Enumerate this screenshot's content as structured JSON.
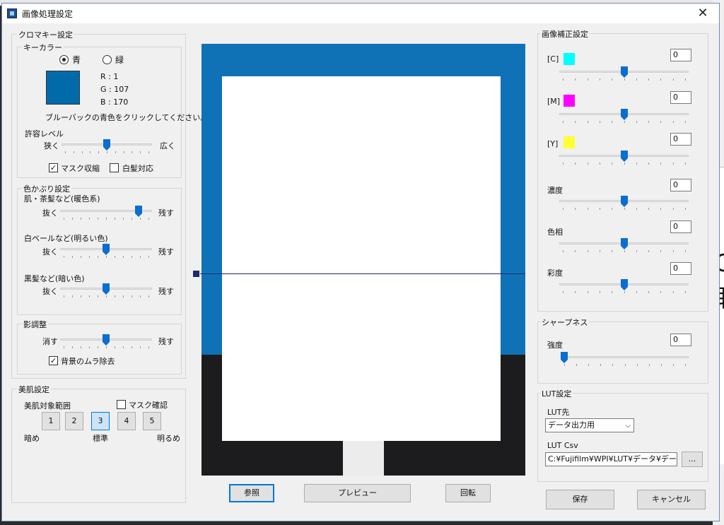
{
  "window": {
    "title": "画像処理設定"
  },
  "chroma": {
    "legend": "クロマキー設定",
    "keycolor": {
      "legend": "キーカラー",
      "blue_label": "青",
      "green_label": "緑",
      "selected": "blue",
      "swatch_color": "#016BAA",
      "r": "R : 1",
      "g": "G : 107",
      "b": "B : 170",
      "hint": "ブルーバックの青色をクリックしてください。"
    },
    "tolerance": {
      "label": "許容レベル",
      "left": "狭く",
      "right": "広く",
      "value": 0.5
    },
    "mask_shrink": {
      "label": "マスク収縮",
      "checked": true
    },
    "white_hair": {
      "label": "白髪対応",
      "checked": false
    }
  },
  "cast": {
    "legend": "色かぶり設定",
    "rows": [
      {
        "title": "肌・茶髪など(暖色系)",
        "left": "抜く",
        "right": "残す",
        "value": 0.88
      },
      {
        "title": "白ベールなど(明るい色)",
        "left": "抜く",
        "right": "残す",
        "value": 0.5
      },
      {
        "title": "黒髪など(暗い色)",
        "left": "抜く",
        "right": "残す",
        "value": 0.5
      }
    ]
  },
  "shadow": {
    "legend": "影調整",
    "left": "消す",
    "right": "残す",
    "value": 0.5,
    "bg_unevenness": {
      "label": "背景のムラ除去",
      "checked": true
    }
  },
  "skin": {
    "legend": "美肌設定",
    "range_label": "美肌対象範囲",
    "mask_check": {
      "label": "マスク確認",
      "checked": false
    },
    "levels": [
      "1",
      "2",
      "3",
      "4",
      "5"
    ],
    "selected_level": "3",
    "dark_label": "暗め",
    "standard_label": "標準",
    "bright_label": "明るめ"
  },
  "preview_buttons": {
    "browse": "参照",
    "preview": "プレビュー",
    "rotate": "回転"
  },
  "correction": {
    "legend": "画像補正設定",
    "rows": [
      {
        "label": "[C]",
        "swatch": "#00FFFF",
        "value": "0",
        "pos": 0.5
      },
      {
        "label": "[M]",
        "swatch": "#FF00FF",
        "value": "0",
        "pos": 0.5
      },
      {
        "label": "[Y]",
        "swatch": "#FFFF33",
        "value": "0",
        "pos": 0.5
      },
      {
        "label": "濃度",
        "swatch": "",
        "value": "0",
        "pos": 0.5
      },
      {
        "label": "色相",
        "swatch": "",
        "value": "0",
        "pos": 0.5
      },
      {
        "label": "彩度",
        "swatch": "",
        "value": "0",
        "pos": 0.5
      }
    ]
  },
  "sharpness": {
    "legend": "シャープネス",
    "label": "強度",
    "value": "0",
    "pos": 0.0
  },
  "lut": {
    "legend": "LUT設定",
    "dest_label": "LUT先",
    "dest_value": "データ出力用",
    "csv_label": "LUT Csv",
    "csv_value": "C:¥Fujifilm¥WPI¥LUT¥データ¥デー",
    "browse_label": "..."
  },
  "footer": {
    "save": "保存",
    "cancel": "キャンセル"
  },
  "background": {
    "glyph_1": "C",
    "glyph_2": "取"
  }
}
